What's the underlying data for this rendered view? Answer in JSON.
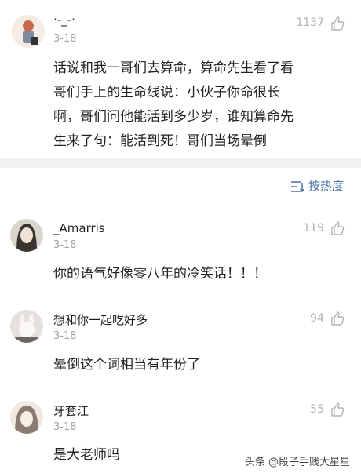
{
  "top_comment": {
    "username": "·-_-·",
    "date": "3-18",
    "likes": "1137",
    "text_lines": [
      "话说和我一哥们去算命，算命先生看了看",
      "哥们手上的生命线说：小伙子你命很长",
      "啊，哥们问他能活到多少岁，谁知算命先",
      "生来了句：能活到死！哥们当场晕倒"
    ]
  },
  "sort": {
    "label": "按热度",
    "icon": "sort-icon"
  },
  "replies": [
    {
      "username": "_Amarris",
      "date": "3-18",
      "likes": "119",
      "text": "你的语气好像零八年的冷笑话！！！"
    },
    {
      "username": "想和你一起吃好多",
      "date": "3-18",
      "likes": "94",
      "text": "晕倒这个词相当有年份了"
    },
    {
      "username": "牙套江",
      "date": "3-18",
      "likes": "55",
      "text": "是大老师吗"
    }
  ],
  "watermark": "头条 @段子手贱大星星",
  "colors": {
    "background": "#ffffff",
    "divider": "#f2f2f2",
    "accent": "#4a6fa5",
    "muted": "#a3a3a3"
  }
}
